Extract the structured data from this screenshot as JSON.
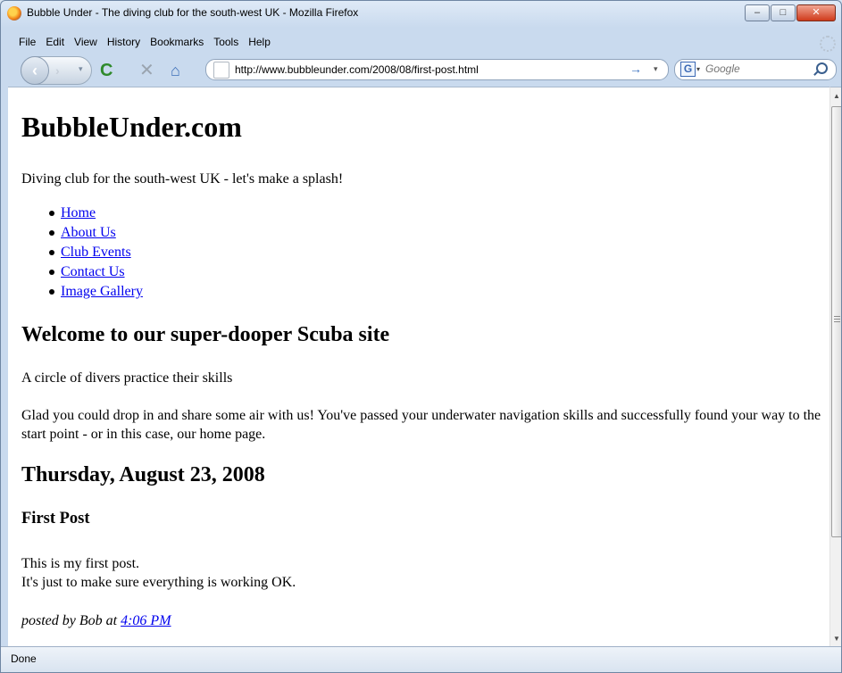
{
  "window": {
    "title": "Bubble Under - The diving club for the south-west UK - Mozilla Firefox",
    "controls": {
      "minimize": "–",
      "maximize": "□",
      "close": "✕"
    }
  },
  "menu": [
    {
      "label": "File"
    },
    {
      "label": "Edit"
    },
    {
      "label": "View"
    },
    {
      "label": "History"
    },
    {
      "label": "Bookmarks"
    },
    {
      "label": "Tools"
    },
    {
      "label": "Help"
    }
  ],
  "toolbar": {
    "back_glyph": "‹",
    "forward_glyph": "›",
    "history_dropdown": "▾",
    "reload_glyph": "C",
    "stop_glyph": "✕",
    "home_glyph": "⌂"
  },
  "address": {
    "url": "http://www.bubbleunder.com/2008/08/first-post.html",
    "go_glyph": "→",
    "dropdown_glyph": "▾"
  },
  "search": {
    "engine_glyph": "G",
    "dropdown_glyph": "▾",
    "placeholder": "Google"
  },
  "page": {
    "site_title": "BubbleUnder.com",
    "tagline": "Diving club for the south-west UK - let's make a splash!",
    "nav": [
      {
        "label": "Home"
      },
      {
        "label": "About Us"
      },
      {
        "label": "Club Events"
      },
      {
        "label": "Contact Us"
      },
      {
        "label": "Image Gallery"
      }
    ],
    "welcome_heading": "Welcome to our super-dooper Scuba site",
    "image_caption": "A circle of divers practice their skills",
    "intro": "Glad you could drop in and share some air with us! You've passed your underwater navigation skills and successfully found your way to the start point - or in this case, our home page.",
    "date_heading": "Thursday, August 23, 2008",
    "post": {
      "title": "First Post",
      "line1": "This is my first post.",
      "line2": "It's just to make sure everything is working OK.",
      "posted_prefix": "posted by Bob at ",
      "time": "4:06 PM"
    }
  },
  "scrollbar": {
    "up": "▲",
    "down": "▼"
  },
  "status": {
    "text": "Done"
  }
}
